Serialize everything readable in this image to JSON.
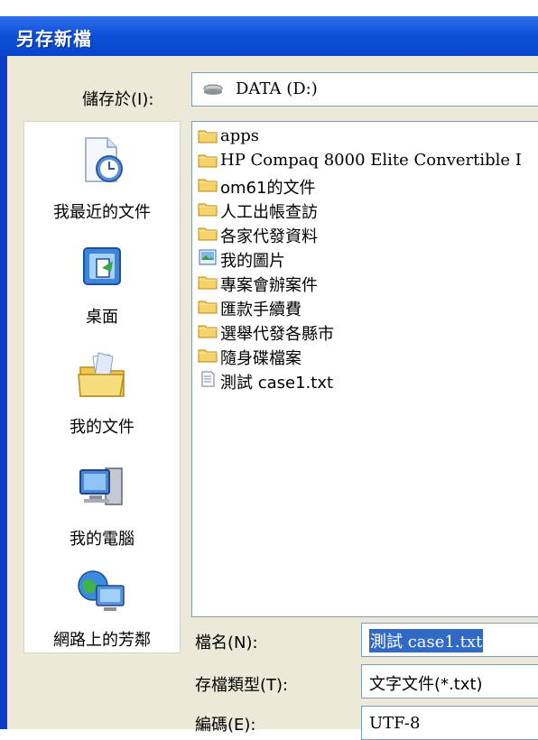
{
  "dialog": {
    "title": "另存新檔"
  },
  "save_in": {
    "label": "儲存於(I):",
    "value": "DATA (D:)"
  },
  "places": [
    {
      "label": "我最近的文件",
      "icon": "recent-documents-icon"
    },
    {
      "label": "桌面",
      "icon": "desktop-icon"
    },
    {
      "label": "我的文件",
      "icon": "my-documents-icon"
    },
    {
      "label": "我的電腦",
      "icon": "my-computer-icon"
    },
    {
      "label": "網路上的芳鄰",
      "icon": "network-places-icon"
    }
  ],
  "files": [
    {
      "name": "apps",
      "type": "folder"
    },
    {
      "name": "HP Compaq 8000 Elite Convertible I",
      "type": "folder"
    },
    {
      "name": "om61的文件",
      "type": "folder"
    },
    {
      "name": "人工出帳查訪",
      "type": "folder"
    },
    {
      "name": "各家代發資料",
      "type": "folder"
    },
    {
      "name": "我的圖片",
      "type": "pictures-folder"
    },
    {
      "name": "專案會辦案件",
      "type": "folder"
    },
    {
      "name": "匯款手續費",
      "type": "folder"
    },
    {
      "name": "選舉代發各縣市",
      "type": "folder"
    },
    {
      "name": "隨身碟檔案",
      "type": "folder"
    },
    {
      "name": "測試 case1.txt",
      "type": "text-file"
    }
  ],
  "filename": {
    "label": "檔名(N):",
    "value": "測試 case1.txt"
  },
  "filetype": {
    "label": "存檔類型(T):",
    "value": "文字文件(*.txt)"
  },
  "encoding": {
    "label": "編碼(E):",
    "value": "UTF-8"
  },
  "colors": {
    "title_bar": "#0b4fd6",
    "dialog_face": "#ece9d8",
    "selection": "#316ac5",
    "folder": "#f5d36a"
  }
}
